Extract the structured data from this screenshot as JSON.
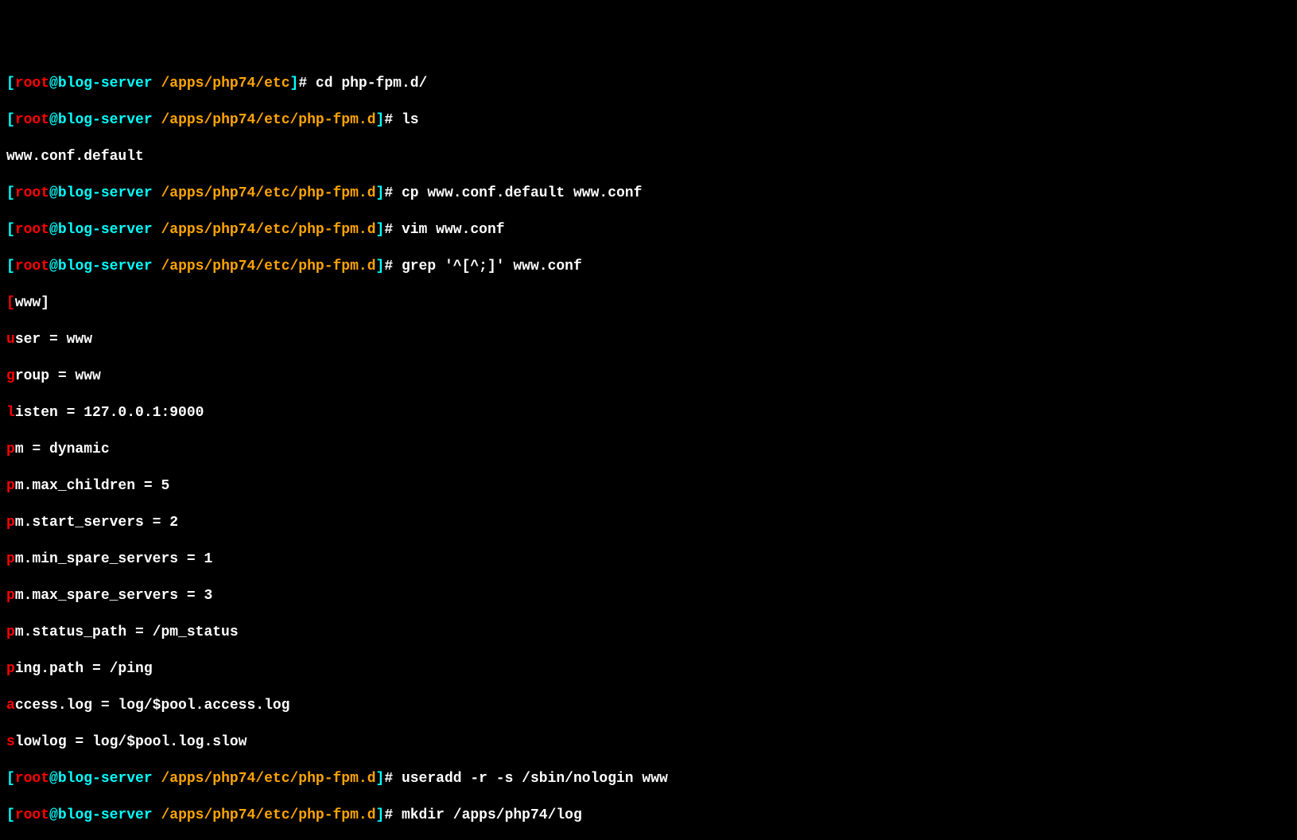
{
  "prompt": {
    "open": "[",
    "user": "root",
    "at": "@",
    "host": "blog-server",
    "close": "]",
    "hash": "# "
  },
  "paths": {
    "etc": " /apps/php74/etc",
    "fpmd": " /apps/php74/etc/php-fpm.d"
  },
  "commands": {
    "cd": "cd php-fpm.d/",
    "ls": "ls",
    "cp": "cp www.conf.default www.conf",
    "vim": "vim www.conf",
    "grep": "grep '^[^;]' www.conf",
    "useradd": "useradd -r -s /sbin/nologin www",
    "mkdir": "mkdir /apps/php74/log"
  },
  "output": {
    "lsResult": "www.conf.default",
    "www": {
      "hl": "[",
      "rest": "www]"
    },
    "user": {
      "hl": "u",
      "rest": "ser = www"
    },
    "group": {
      "hl": "g",
      "rest": "roup = www"
    },
    "listen": {
      "hl": "l",
      "rest": "isten = 127.0.0.1:9000"
    },
    "pm": {
      "hl": "p",
      "rest": "m = dynamic"
    },
    "max_children": {
      "hl": "p",
      "rest": "m.max_children = 5"
    },
    "start_servers": {
      "hl": "p",
      "rest": "m.start_servers = 2"
    },
    "min_spare": {
      "hl": "p",
      "rest": "m.min_spare_servers = 1"
    },
    "max_spare": {
      "hl": "p",
      "rest": "m.max_spare_servers = 3"
    },
    "status_path": {
      "hl": "p",
      "rest": "m.status_path = /pm_status"
    },
    "ping": {
      "hl": "p",
      "rest": "ing.path = /ping"
    },
    "access": {
      "hl": "a",
      "rest": "ccess.log = log/$pool.access.log"
    },
    "slowlog": {
      "hl": "s",
      "rest": "lowlog = log/$pool.log.slow"
    }
  }
}
